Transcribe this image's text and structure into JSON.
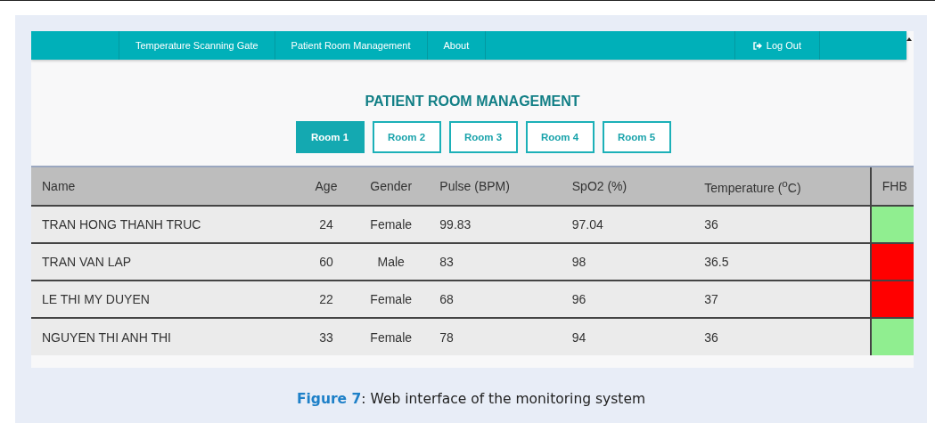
{
  "nav": {
    "items": [
      {
        "label": "Temperature Scanning Gate",
        "selected": false
      },
      {
        "label": "Patient Room Management",
        "selected": false
      },
      {
        "label": "About",
        "selected": false
      }
    ],
    "logout": "Log Out"
  },
  "heading": "PATIENT ROOM MANAGEMENT",
  "rooms": [
    {
      "label": "Room 1",
      "selected": true
    },
    {
      "label": "Room 2",
      "selected": false
    },
    {
      "label": "Room 3",
      "selected": false
    },
    {
      "label": "Room 4",
      "selected": false
    },
    {
      "label": "Room 5",
      "selected": false
    }
  ],
  "table": {
    "columns": [
      "Name",
      "Age",
      "Gender",
      "Pulse (BPM)",
      "SpO2 (%)",
      "Temperature ($^{o}$C)",
      "FHB"
    ],
    "rows": [
      {
        "cells": [
          "TRAN HONG THANH TRUC",
          "24",
          "Female",
          "99.83",
          "97.04",
          "36"
        ],
        "color": "#90ee90"
      },
      {
        "cells": [
          "TRAN VAN LAP",
          "60",
          "Male",
          "83",
          "98",
          "36.5"
        ],
        "color": "#ff0000"
      },
      {
        "cells": [
          "LE THI MY DUYEN",
          "22",
          "Female",
          "68",
          "96",
          "37"
        ],
        "color": "#ff0000"
      },
      {
        "cells": [
          "NGUYEN THI ANH THI",
          "33",
          "Female",
          "78",
          "94",
          "36"
        ],
        "color": "#90ee90"
      }
    ]
  },
  "caption": "**Figure 7**: Web interface of the monitoring system"
}
